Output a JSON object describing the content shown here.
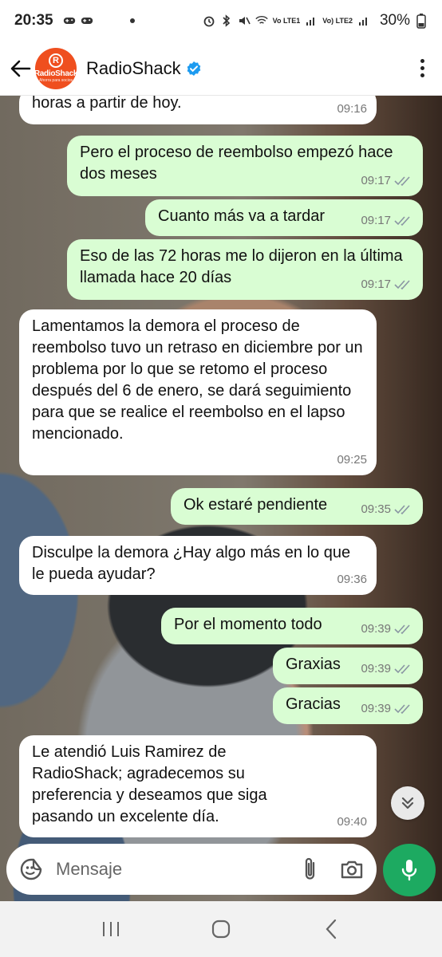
{
  "status_bar": {
    "time": "20:35",
    "network_1": "Vo LTE1",
    "network_2": "Vo) LTE2",
    "battery": "30%"
  },
  "header": {
    "contact_name": "RadioShack",
    "avatar_brand": "RadioShack",
    "avatar_tagline": "Ahorra para socios",
    "verified": true
  },
  "messages": [
    {
      "direction": "in",
      "text": "horas a partir de hoy.",
      "time": "09:16"
    },
    {
      "direction": "out",
      "text": "Pero el proceso de reembolso empezó hace dos meses",
      "time": "09:17",
      "read": true
    },
    {
      "direction": "out",
      "text": "Cuanto más va a tardar",
      "time": "09:17",
      "read": true
    },
    {
      "direction": "out",
      "text": "Eso de las 72 horas me lo dijeron en la última llamada hace 20 días",
      "time": "09:17",
      "read": true
    },
    {
      "direction": "in",
      "text": "Lamentamos la demora el proceso de reembolso tuvo un retraso en diciembre por un problema por lo que se retomo el proceso después del 6 de enero, se dará seguimiento para que se realice el reembolso en el lapso mencionado.",
      "time": "09:25"
    },
    {
      "direction": "out",
      "text": "Ok estaré pendiente",
      "time": "09:35",
      "read": true
    },
    {
      "direction": "in",
      "text": "Disculpe la demora ¿Hay algo más en lo que le pueda ayudar?",
      "time": "09:36"
    },
    {
      "direction": "out",
      "text": "Por el momento todo",
      "time": "09:39",
      "read": true
    },
    {
      "direction": "out",
      "text": "Graxias",
      "time": "09:39",
      "read": true
    },
    {
      "direction": "out",
      "text": "Gracias",
      "time": "09:39",
      "read": true
    },
    {
      "direction": "in",
      "text": "Le atendió Luis Ramirez de RadioShack; agradecemos su preferencia y deseamos que siga pasando un excelente día.",
      "time": "09:40"
    }
  ],
  "composer": {
    "placeholder": "Mensaje"
  },
  "colors": {
    "incoming_bubble": "#ffffff",
    "outgoing_bubble": "#d9fdd3",
    "mic_button": "#1daa61",
    "read_ticks": "#8a96a3",
    "brand": "#ef4f1f",
    "verified": "#1d9bf0"
  },
  "icons": {
    "back": "arrow-left-icon",
    "menu": "more-vert-icon",
    "sticker": "sticker-icon",
    "attach": "paperclip-icon",
    "camera": "camera-icon",
    "mic": "microphone-icon",
    "scroll": "double-chevron-down-icon"
  }
}
